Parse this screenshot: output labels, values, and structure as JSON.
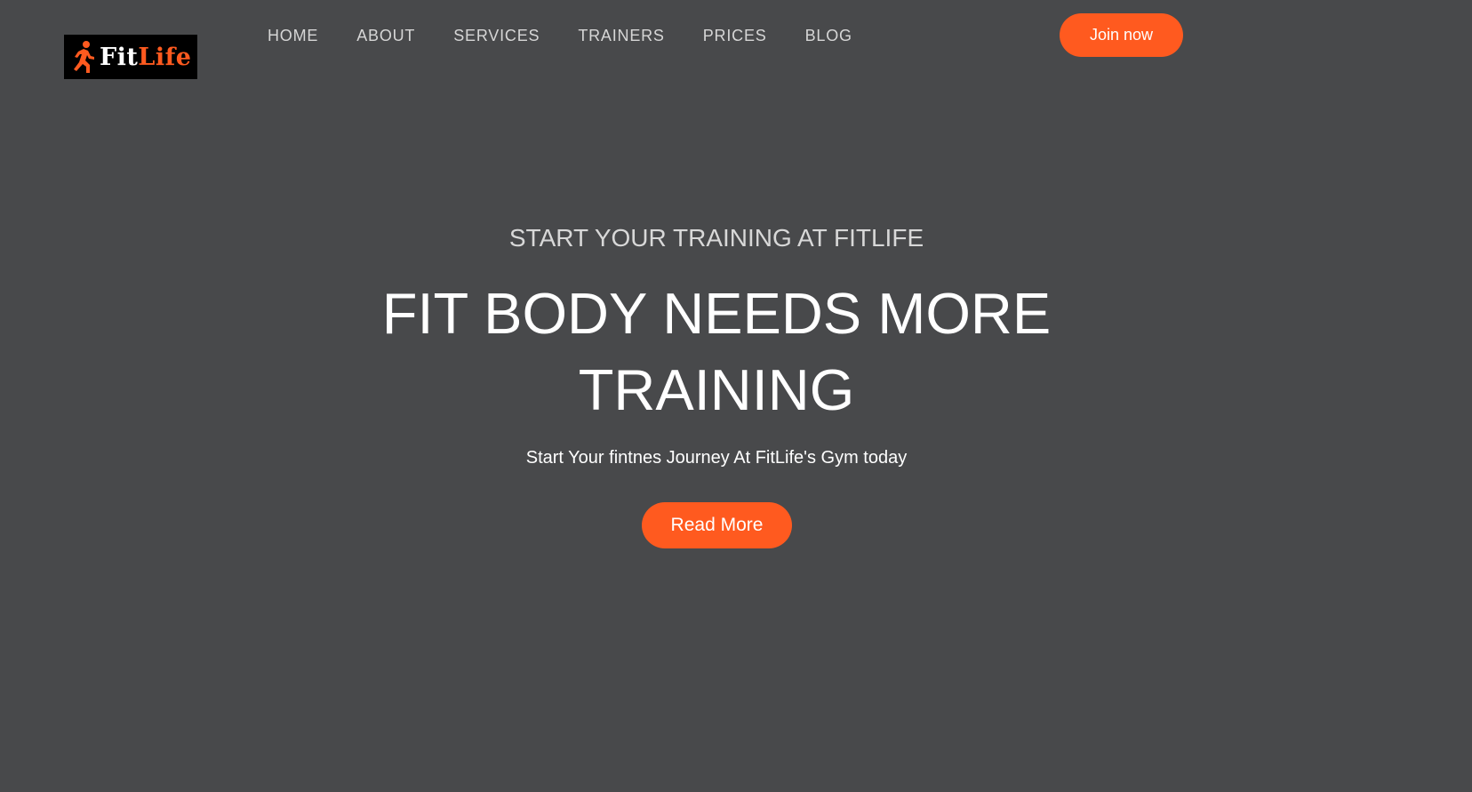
{
  "brand": {
    "logo_fit": "Fit",
    "logo_life": "Life",
    "logo_icon": "running-person-icon",
    "accent_color": "#ff5a1f",
    "background_color": "#48494b"
  },
  "nav": {
    "items": [
      {
        "label": "HOME"
      },
      {
        "label": "ABOUT"
      },
      {
        "label": "SERVICES"
      },
      {
        "label": "TRAINERS"
      },
      {
        "label": "PRICES"
      },
      {
        "label": "BLOG"
      }
    ],
    "join_label": "Join now"
  },
  "hero": {
    "subtitle": "START YOUR TRAINING AT FITLIFE",
    "title_line1": "FIT BODY NEEDS MORE",
    "title_line2": "TRAINING",
    "description": "Start Your fintnes Journey At FitLife's Gym today",
    "cta_label": "Read More"
  }
}
